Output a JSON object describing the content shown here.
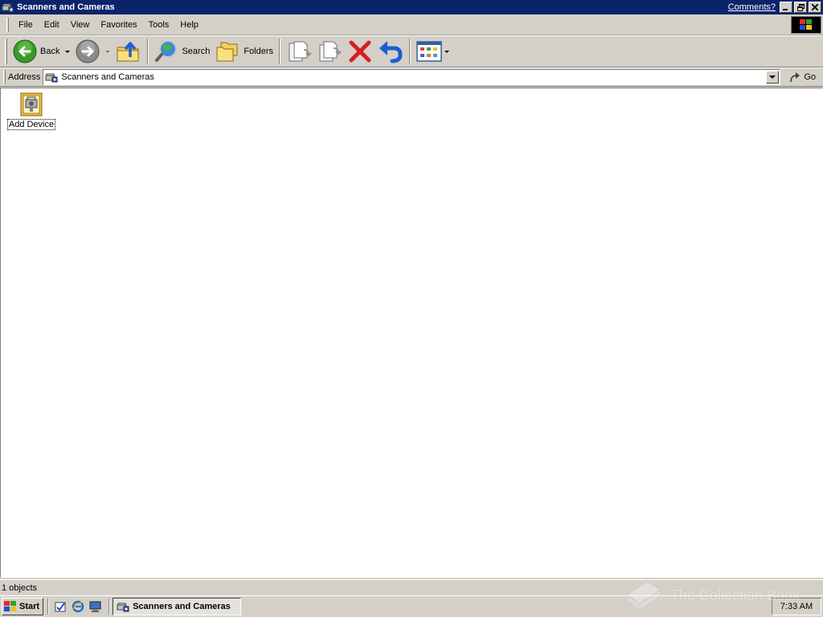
{
  "window": {
    "title": "Scanners and Cameras",
    "comments_link": "Comments?",
    "app_icon": "scanner-camera-icon"
  },
  "menu": {
    "items": [
      {
        "label": "File"
      },
      {
        "label": "Edit"
      },
      {
        "label": "View"
      },
      {
        "label": "Favorites"
      },
      {
        "label": "Tools"
      },
      {
        "label": "Help"
      }
    ]
  },
  "toolbar": {
    "back_label": "Back",
    "search_label": "Search",
    "folders_label": "Folders"
  },
  "address": {
    "label": "Address",
    "value": "Scanners and Cameras",
    "go_label": "Go"
  },
  "content": {
    "items": [
      {
        "label": "Add Device",
        "icon": "add-device-icon"
      }
    ]
  },
  "status": {
    "text": "1 objects"
  },
  "taskbar": {
    "start_label": "Start",
    "task_label": "Scanners and Cameras",
    "clock": "7:33 AM",
    "watermark": "The Collection Book"
  },
  "colors": {
    "titlebar": "#0a246a",
    "face": "#d4d0c8",
    "content_bg": "#ffffff",
    "back_green": "#3a9a2a",
    "delete_red": "#d42020",
    "undo_blue": "#1a5fd0"
  }
}
